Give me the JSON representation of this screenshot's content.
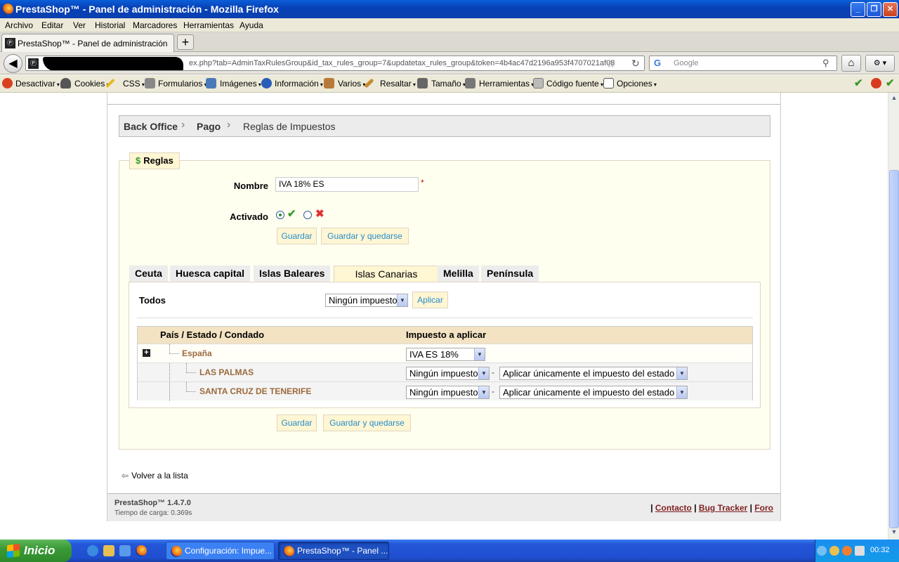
{
  "window": {
    "title": "PrestaShop™ - Panel de administración - Mozilla Firefox",
    "min_symbol": "_",
    "max_symbol": "❐",
    "close_symbol": "✕"
  },
  "menubar": [
    "Archivo",
    "Editar",
    "Ver",
    "Historial",
    "Marcadores",
    "Herramientas",
    "Ayuda"
  ],
  "browser_tab": {
    "title": "PrestaShop™ - Panel de administración",
    "new_tab_symbol": "+"
  },
  "address_bar": {
    "url_visible": "ex.php?tab=AdminTaxRulesGroup&id_tax_rules_group=7&updatetax_rules_group&token=4b4ac47d2196a953f4707021af08",
    "favicon_text": "Ⓟ"
  },
  "search_bar": {
    "placeholder": "Google"
  },
  "dev_toolbar": [
    "Desactivar",
    "Cookies",
    "CSS",
    "Formularios",
    "Imágenes",
    "Información",
    "Varios",
    "Resaltar",
    "Tamaño",
    "Herramientas",
    "Código fuente",
    "Opciones"
  ],
  "breadcrumb": {
    "items": [
      "Back Office",
      "Pago",
      "Reglas de Impuestos"
    ],
    "separator": "›"
  },
  "form": {
    "legend": "Reglas",
    "legend_icon": "$",
    "name_label": "Nombre",
    "name_value": "IVA 18% ES",
    "required_mark": "*",
    "active_label": "Activado",
    "active_yes": true,
    "check_symbol": "✔",
    "cross_symbol": "✖",
    "save_label": "Guardar",
    "save_stay_label": "Guardar y quedarse"
  },
  "region_tabs": {
    "items": [
      "Ceuta",
      "Huesca capital",
      "Islas Baleares",
      "Islas Canarias",
      "Melilla",
      "Península"
    ],
    "active": "Islas Canarias"
  },
  "tab_panel": {
    "all_label": "Todos",
    "all_select": "Ningún impuesto",
    "apply_label": "Aplicar",
    "columns": [
      "País / Estado / Condado",
      "Impuesto a aplicar"
    ],
    "rows": [
      {
        "name": "España",
        "tax": "IVA ES 18%",
        "behavior": "",
        "expand_symbol": "+"
      },
      {
        "name": "LAS PALMAS",
        "tax": "Ningún impuesto",
        "behavior": "Aplicar únicamente el impuesto del estado",
        "separator": "-"
      },
      {
        "name": "SANTA CRUZ DE TENERIFE",
        "tax": "Ningún impuesto",
        "behavior": "Aplicar únicamente el impuesto del estado",
        "separator": "-"
      }
    ]
  },
  "back_link": "Volver a la lista",
  "footer": {
    "version": "PrestaShop™ 1.4.7.0",
    "load_time": "Tiempo de carga: 0.369s",
    "links": [
      "Contacto",
      "Bug Tracker",
      "Foro"
    ]
  },
  "taskbar": {
    "start_label": "Inicio",
    "tasks": [
      "Configuración: Impue...",
      "PrestaShop™ - Panel ..."
    ],
    "clock": "00:32"
  },
  "colors": {
    "accent": "#268ccd",
    "legend_bg": "#fff6d3",
    "grid_header": "#f3e3c3",
    "region_name": "#9b6a3b",
    "footer_link": "#802020"
  }
}
